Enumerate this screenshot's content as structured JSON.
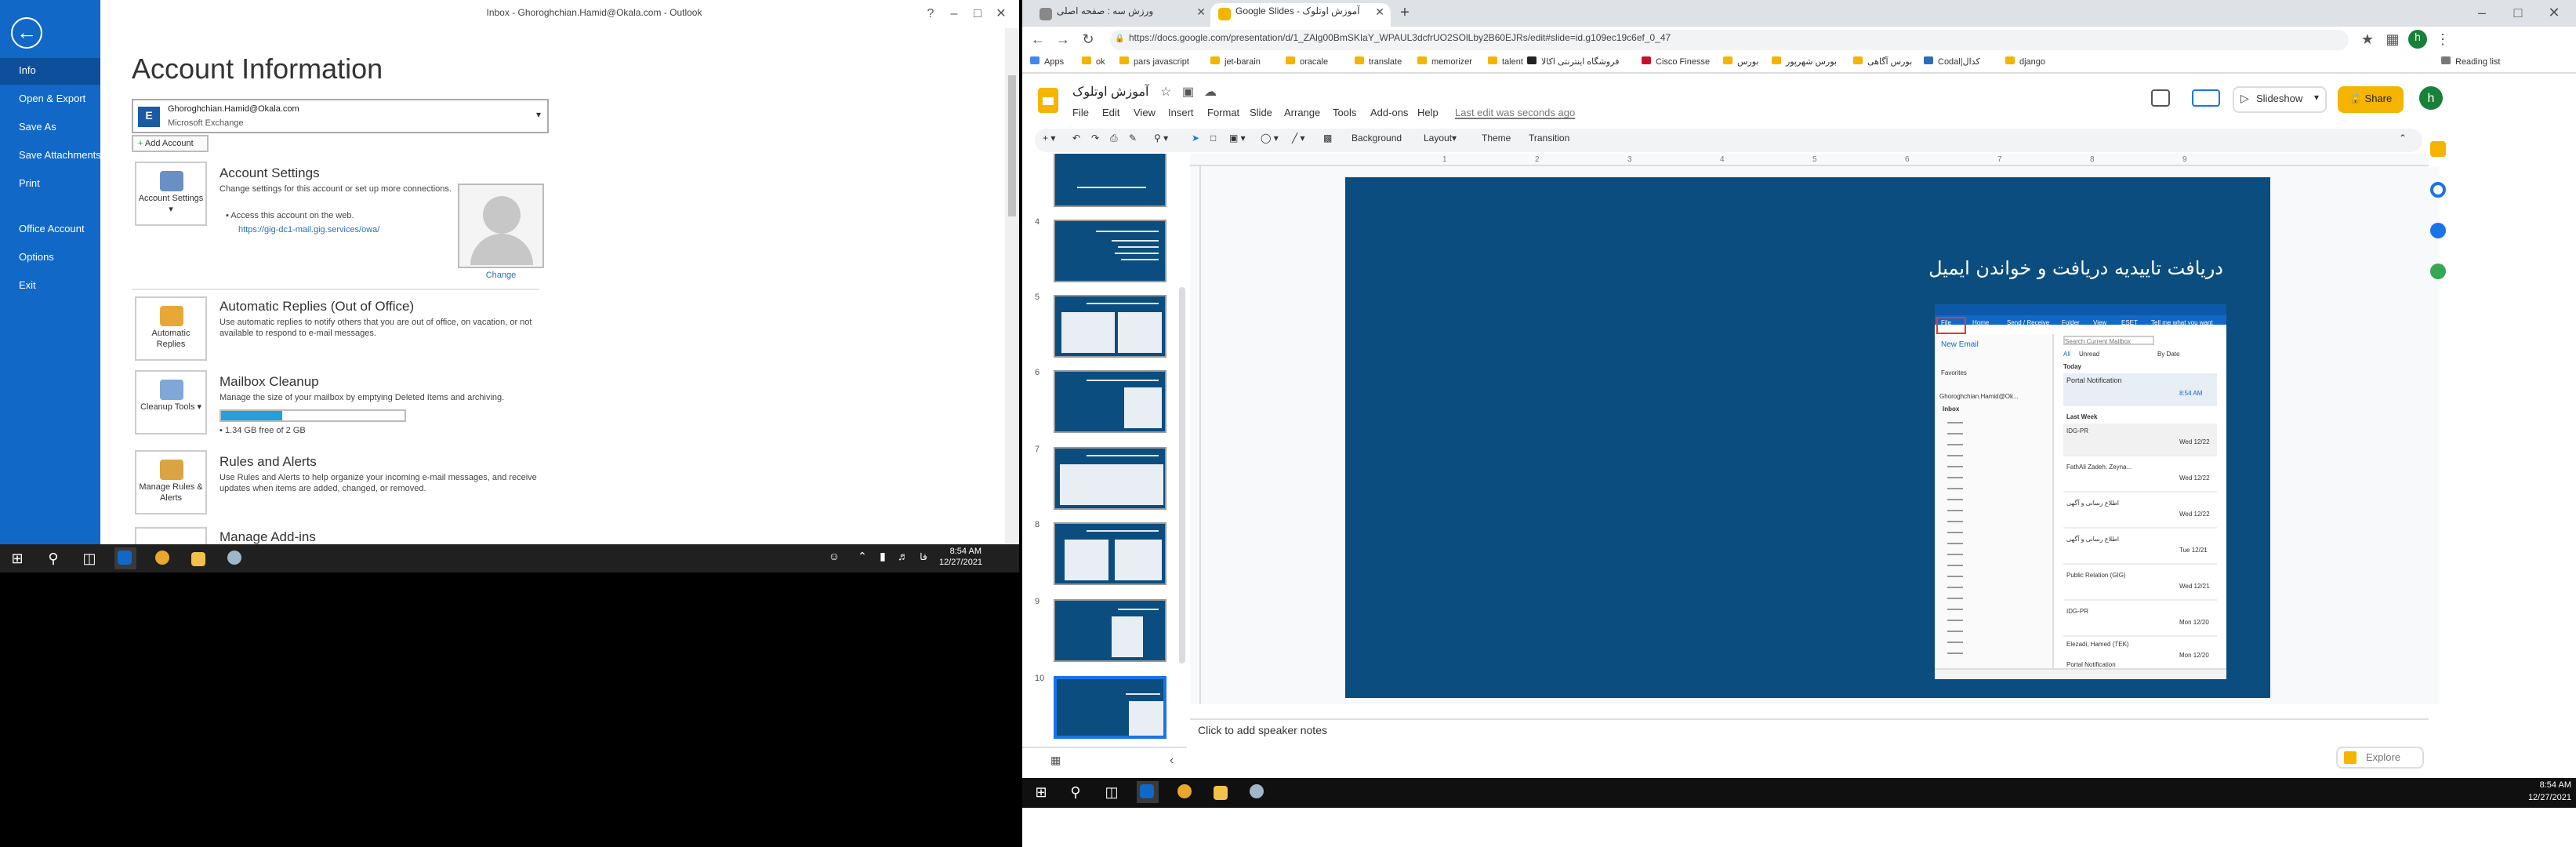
{
  "outlook": {
    "window_title": "Inbox - Ghoroghchian.Hamid@Okala.com - Outlook",
    "nav": [
      "Info",
      "Open & Export",
      "Save As",
      "Save Attachments",
      "Print",
      "Office Account",
      "Options",
      "Exit"
    ],
    "heading": "Account Information",
    "account_email": "Ghoroghchian.Hamid@Okala.com",
    "account_type": "Microsoft Exchange",
    "add_account": "Add Account",
    "account_settings": {
      "button": "Account Settings",
      "title": "Account Settings",
      "text": "Change settings for this account or set up more connections.",
      "bullet": "Access this account on the web.",
      "link": "https://gig-dc1-mail.gig.services/owa/"
    },
    "change_photo": "Change",
    "auto_replies": {
      "button": "Automatic Replies",
      "title": "Automatic Replies (Out of Office)",
      "text": "Use automatic replies to notify others that you are out of office, on vacation, or not available to respond to e-mail messages."
    },
    "cleanup": {
      "button": "Cleanup Tools",
      "title": "Mailbox Cleanup",
      "text": "Manage the size of your mailbox by emptying Deleted Items and archiving.",
      "storage": "1.34 GB free of 2 GB",
      "used_fraction": 0.33
    },
    "rules": {
      "button": "Manage Rules & Alerts",
      "title": "Rules and Alerts",
      "text": "Use Rules and Alerts to help organize your incoming e-mail messages, and receive updates when items are added, changed, or removed."
    },
    "addins_title": "Manage Add-ins"
  },
  "taskbar_left": {
    "time": "8:54 AM",
    "date": "12/27/2021"
  },
  "chrome": {
    "tabs": [
      {
        "title": "ورزش سه : صفحه اصلی",
        "active": false
      },
      {
        "title": "Google Slides - آموزش اوتلوک",
        "active": true
      }
    ],
    "url": "https://docs.google.com/presentation/d/1_ZAlg00BmSKIaY_WPAUL3dcfrUO2SOlLby2B60EJRs/edit#slide=id.g109ec19c6ef_0_47",
    "bookmarks": [
      "Apps",
      "ok",
      "pars javascript",
      "jet-barain",
      "oracale",
      "translate",
      "memorizer",
      "talent",
      "فروشگاه اینترنتی اکالا",
      "Cisco Finesse",
      "بورس",
      "بورس شهرپور",
      "بورس آگاهی",
      "Codal|کدال",
      "django"
    ],
    "reading_list": "Reading list"
  },
  "slides": {
    "doc_name": "آموزش اوتلوک",
    "menus": [
      "File",
      "Edit",
      "View",
      "Insert",
      "Format",
      "Slide",
      "Arrange",
      "Tools",
      "Add-ons",
      "Help"
    ],
    "last_edit": "Last edit was seconds ago",
    "slideshow": "Slideshow",
    "share": "Share",
    "user_initial": "h",
    "toolbar": [
      "Background",
      "Layout▾",
      "Theme",
      "Transition"
    ],
    "ruler_marks": [
      "1",
      "2",
      "3",
      "4",
      "5",
      "6",
      "7",
      "8",
      "9"
    ],
    "thumb_numbers": [
      "4",
      "5",
      "6",
      "7",
      "8",
      "9",
      "10"
    ],
    "slide_title": "دریافت تاییدیه دریافت و خواندن ایمیل",
    "notes_placeholder": "Click to add speaker notes",
    "explore": "Explore",
    "screenshot": {
      "ribbon": [
        "File",
        "Home",
        "Send / Receive",
        "Folder",
        "View",
        "ESET",
        "Tell me what you want"
      ],
      "new_email": "New Email",
      "search": "Search Current Mailbox",
      "filter_all": "All",
      "filter_unread": "Unread",
      "sort": "By Date",
      "favorites": "Favorites",
      "account": "Ghoroghchian.Hamid@Ok...",
      "inbox": "Inbox",
      "today": "Today",
      "last_week": "Last Week",
      "mails": [
        {
          "from": "Portal Notification",
          "time": "8:54 AM"
        },
        {
          "from": "IDG-PR",
          "time": "Wed 12/22"
        },
        {
          "from": "FathAli Zadeh, Zeyna...",
          "time": "Wed 12/22"
        },
        {
          "from": "اطلاع رسانی و آگهی",
          "time": "Wed 12/22"
        },
        {
          "from": "اطلاع رسانی و آگهی",
          "time": "Tue 12/21"
        },
        {
          "from": "Public Relation (GIG)",
          "time": "Wed 12/21"
        },
        {
          "from": "IDG-PR",
          "time": "Mon 12/20"
        },
        {
          "from": "Elezadi, Hamed (TEK)",
          "time": "Mon 12/20"
        },
        {
          "from": "Portal Notification",
          "time": ""
        }
      ]
    }
  },
  "taskbar_right": {
    "time": "8:54 AM",
    "date": "12/27/2021"
  }
}
